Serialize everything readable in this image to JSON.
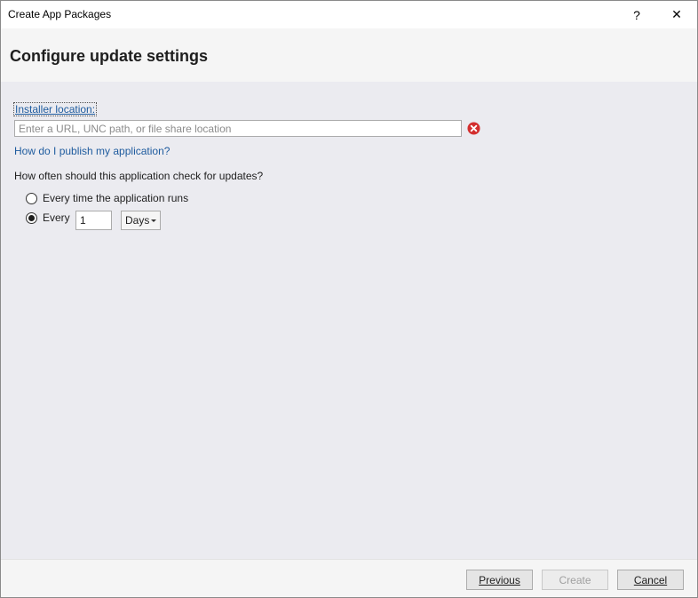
{
  "window": {
    "title": "Create App Packages",
    "help_glyph": "?",
    "close_glyph": "✕"
  },
  "header": {
    "title": "Configure update settings"
  },
  "installer": {
    "label": "Installer location:",
    "value": "",
    "placeholder": "Enter a URL, UNC path, or file share location",
    "error_icon": "error-x-circle-icon"
  },
  "help_link": "How do I publish my application?",
  "update_check": {
    "question": "How often should this application check for updates?",
    "option_every_run": "Every time the application runs",
    "option_every": "Every",
    "selected": "every",
    "interval_value": "1",
    "unit_selected": "Days"
  },
  "footer": {
    "previous_label": "Previous",
    "create_label": "Create",
    "cancel_label": "Cancel"
  },
  "colors": {
    "link": "#1e5b9e",
    "error": "#d32f2f",
    "content_bg": "#ebebf0"
  }
}
